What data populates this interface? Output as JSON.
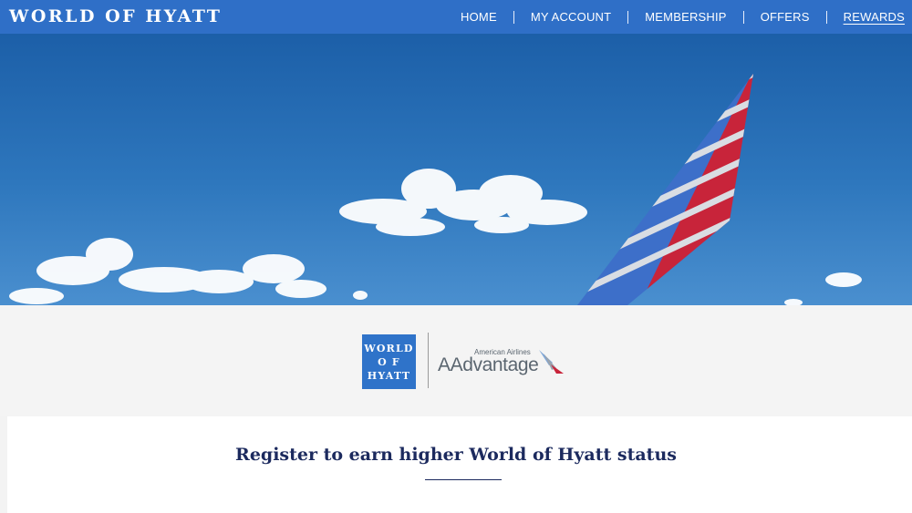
{
  "header": {
    "brand": "WORLD OF HYATT",
    "nav": [
      {
        "label": "HOME"
      },
      {
        "label": "MY ACCOUNT"
      },
      {
        "label": "MEMBERSHIP"
      },
      {
        "label": "OFFERS"
      },
      {
        "label": "REWARDS",
        "active": true
      }
    ]
  },
  "partner_logos": {
    "hyatt_lines": [
      "WORLD",
      "O F",
      "HYATT"
    ],
    "aa_small": "American Airlines",
    "aa_main": "AAdvantage"
  },
  "main": {
    "title": "Register to earn higher World of Hyatt status"
  },
  "colors": {
    "brand_blue": "#2f6fc7",
    "title_navy": "#1c2a5e",
    "aa_red": "#c8243a",
    "aa_blue": "#3d6fc9"
  }
}
